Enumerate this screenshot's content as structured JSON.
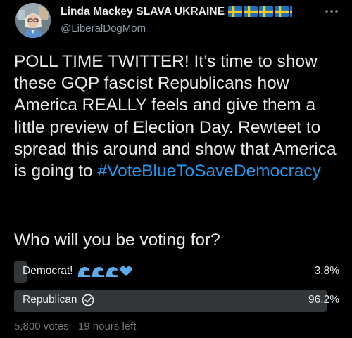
{
  "author": {
    "name": "Linda Mackey SLAVA UKRAINE",
    "handle": "@LiberalDogMom",
    "flags": [
      "sweden-flag",
      "sweden-flag",
      "sweden-flag",
      "sweden-flag",
      "sweden-flag"
    ]
  },
  "tweet": {
    "text": "POLL TIME TWITTER! It’s time to show these GQP fascist Republicans how America REALLY feels and give them a little preview of Election Day. Rewteet to spread this around and show that America is going to",
    "hashtag": "#VoteBlueToSaveDemocracy"
  },
  "poll": {
    "question": "Who will you be voting for?",
    "options": [
      {
        "label": "Democrat!",
        "emoji": [
          "water-wave",
          "water-wave",
          "water-wave",
          "blue-heart"
        ],
        "percent_text": "3.8%",
        "percent": 3.8,
        "selected": false
      },
      {
        "label": "Republican",
        "emoji": [
          "check-circle-icon"
        ],
        "percent_text": "96.2%",
        "percent": 96.2,
        "selected": true
      }
    ],
    "votes": "5,800 votes",
    "separator": "·",
    "time_left": "19 hours left"
  },
  "colors": {
    "background": "#000000",
    "text": "#e7e9ea",
    "muted": "#8b98a5",
    "link": "#1d9bf0",
    "poll_bar": "#333639",
    "emoji_blue": "#5dadec"
  },
  "icons": {
    "more": "more-horizontal-icon",
    "avatar": "avatar"
  }
}
